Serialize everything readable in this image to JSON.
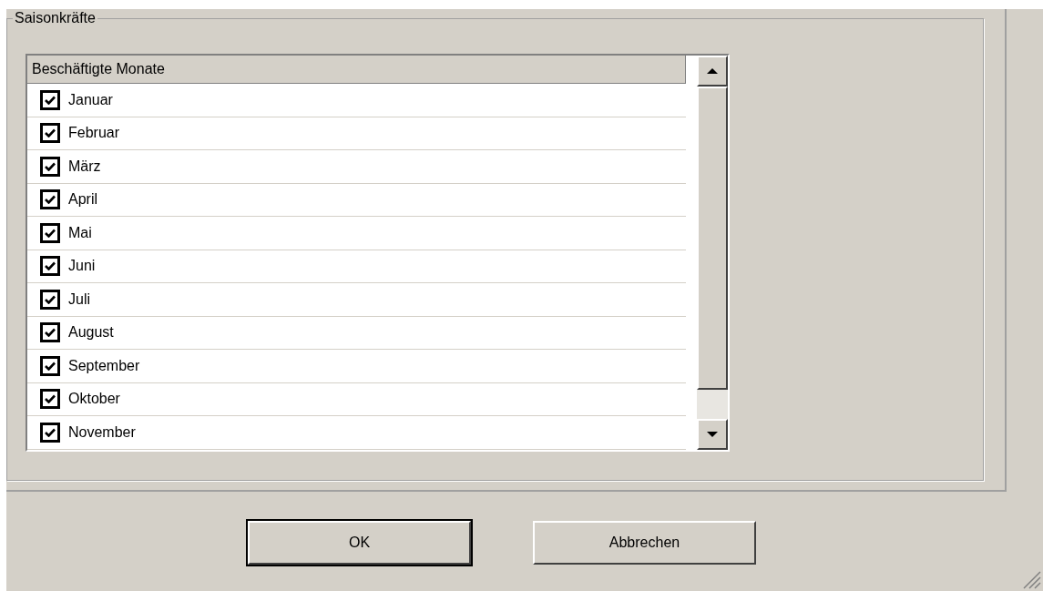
{
  "group": {
    "title": "Saisonkräfte"
  },
  "list": {
    "column": "Beschäftigte Monate",
    "rows": [
      {
        "label": "Januar",
        "checked": true
      },
      {
        "label": "Februar",
        "checked": true
      },
      {
        "label": "März",
        "checked": true
      },
      {
        "label": "April",
        "checked": true
      },
      {
        "label": "Mai",
        "checked": true
      },
      {
        "label": "Juni",
        "checked": true
      },
      {
        "label": "Juli",
        "checked": true
      },
      {
        "label": "August",
        "checked": true
      },
      {
        "label": "September",
        "checked": true
      },
      {
        "label": "Oktober",
        "checked": true
      },
      {
        "label": "November",
        "checked": true
      }
    ]
  },
  "buttons": [
    {
      "label": "OK",
      "default": true
    },
    {
      "label": "Abbrechen",
      "default": false
    }
  ]
}
